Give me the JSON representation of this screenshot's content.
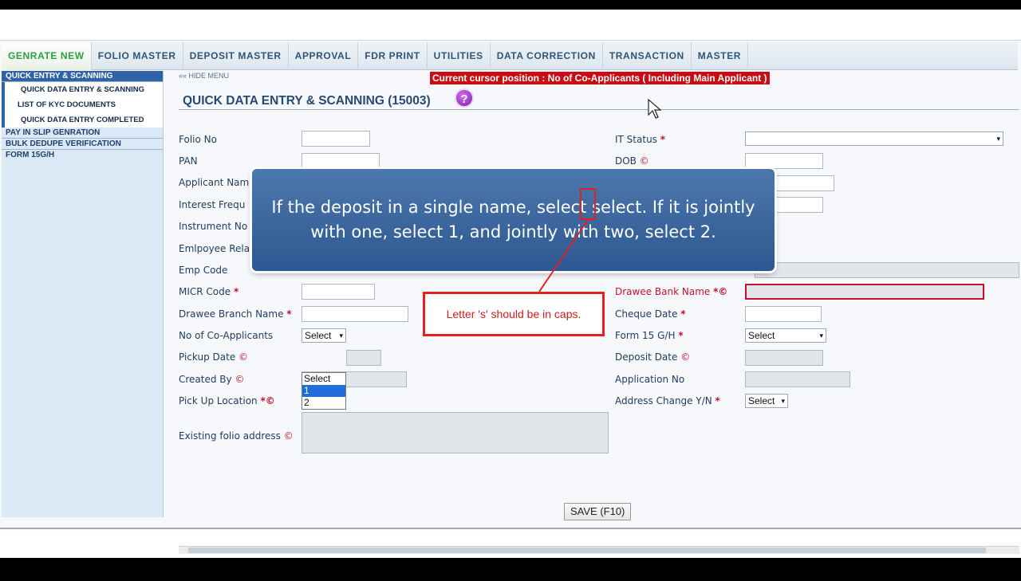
{
  "nav": {
    "items": [
      "GENRATE NEW",
      "FOLIO MASTER",
      "DEPOSIT MASTER",
      "APPROVAL",
      "FDR PRINT",
      "UTILITIES",
      "DATA CORRECTION",
      "TRANSACTION",
      "MASTER"
    ]
  },
  "sidebar": {
    "section_active": "QUICK ENTRY & SCANNING",
    "sub_items": [
      "QUICK DATA ENTRY & SCANNING",
      "LIST OF KYC DOCUMENTS",
      "QUICK DATA ENTRY COMPLETED"
    ],
    "sections": [
      "PAY IN SLIP GENRATION",
      "BULK DEDUPE VERIFICATION",
      "FORM 15G/H"
    ]
  },
  "main": {
    "hide_menu": "«« HIDE MENU",
    "cursor_banner": "Current cursor position : No of Co-Applicants ( Including Main Applicant )",
    "title": "QUICK DATA ENTRY & SCANNING (15003)",
    "help_icon": "?"
  },
  "form_left": {
    "folio_no": "Folio No",
    "pan": "PAN",
    "applicant_name": "Applicant Nam",
    "interest_freq": "Interest Frequ",
    "instrument_no": "Instrument No",
    "employee_rel": "Emlpoyee Rela",
    "emp_code": "Emp Code",
    "micr_code": "MICR Code",
    "drawee_branch": "Drawee Branch Name",
    "no_coapplicants": "No of Co-Applicants",
    "pickup_date": "Pickup Date",
    "created_by": "Created By",
    "pickup_location": "Pick Up Location",
    "existing_folio_address": "Existing folio address"
  },
  "form_right": {
    "it_status": "IT Status",
    "dob": "DOB",
    "drawee_bank": "Drawee Bank Name",
    "cheque_date": "Cheque Date",
    "form15": "Form 15 G/H",
    "deposit_date": "Deposit Date",
    "application_no": "Application No",
    "address_change": "Address Change Y/N"
  },
  "selects": {
    "coapplicants_value": "Select",
    "coapplicants_options": [
      "Select",
      "1",
      "2"
    ],
    "form15_value": "Select",
    "address_change_value": "Select"
  },
  "save_button": "SAVE (F10)",
  "callout": {
    "line1": "If the deposit in a single name, select select. If it is jointly",
    "line2": "with one, select 1, and jointly with two, select 2."
  },
  "note": "Letter 's' should be in caps.",
  "colors": {
    "accent": "#2f63a8",
    "banner": "#c50f14",
    "callout": "#3a679e",
    "annotation": "#e0211e"
  }
}
